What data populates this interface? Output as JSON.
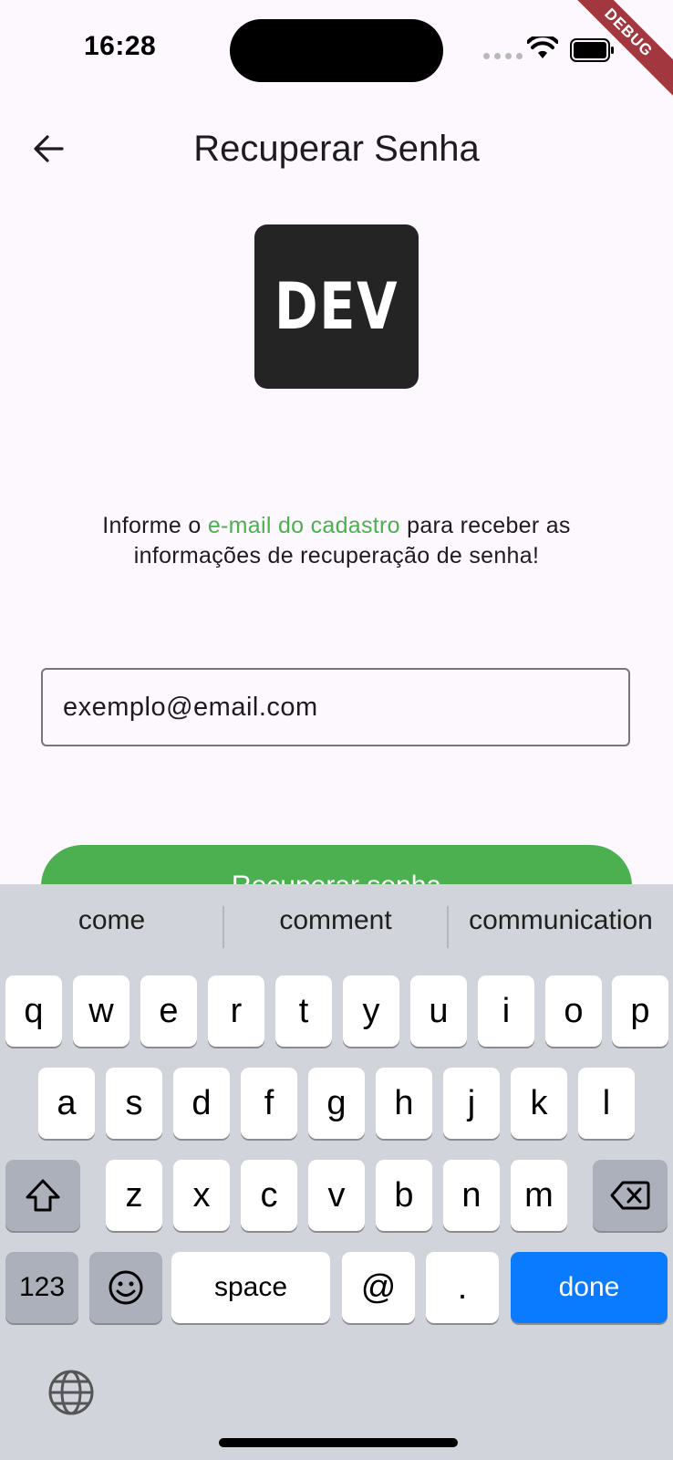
{
  "status_bar": {
    "time": "16:28",
    "debug_label": "DEBUG"
  },
  "app_bar": {
    "title": "Recuperar Senha"
  },
  "logo": {
    "text": "DEV"
  },
  "info": {
    "prefix": "Informe o ",
    "highlight": "e-mail do cadastro",
    "suffix": " para receber as informações de recuperação de senha!",
    "highlight_color": "#4caf50"
  },
  "email_field": {
    "placeholder": "exemplo@email.com"
  },
  "submit_button": {
    "label": "Recuperar senha"
  },
  "keyboard": {
    "suggestions": [
      "come",
      "comment",
      "communication"
    ],
    "row1": [
      "q",
      "w",
      "e",
      "r",
      "t",
      "y",
      "u",
      "i",
      "o",
      "p"
    ],
    "row2": [
      "a",
      "s",
      "d",
      "f",
      "g",
      "h",
      "j",
      "k",
      "l"
    ],
    "row3": [
      "z",
      "x",
      "c",
      "v",
      "b",
      "n",
      "m"
    ],
    "numbers_label": "123",
    "space_label": "space",
    "at_label": "@",
    "dot_label": ".",
    "done_label": "done",
    "done_color": "#0a7bff"
  }
}
